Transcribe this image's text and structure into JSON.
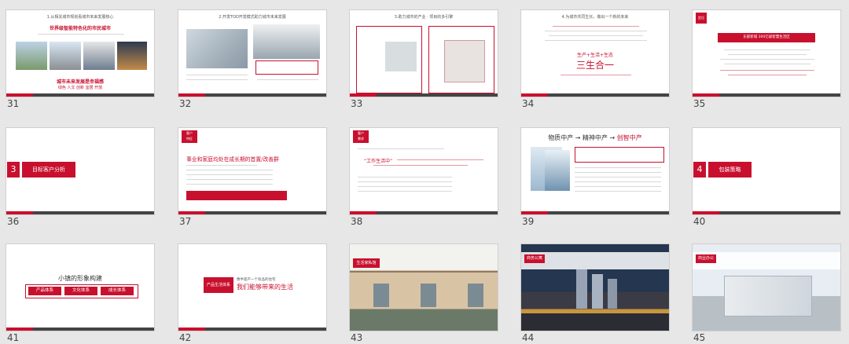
{
  "colors": {
    "accent": "#c8102e",
    "background": "#e7e7e7"
  },
  "slides": [
    {
      "number": "31",
      "title": "1.从相关城市规划看城市未来发展核心",
      "headline": "世界级智能特色化的市民城市",
      "subline": "城市未来发展是幸福感",
      "keywords": "绿色 人文 创新 宜居 开放"
    },
    {
      "number": "32",
      "title": "2.开发TOD开发模式助力城市未来发展"
    },
    {
      "number": "33",
      "title": "3.助力城市的产业 · 项目的多引擎"
    },
    {
      "number": "34",
      "title": "4.为城市共同生长，做出一个新的未来",
      "banner": "生产+生活+生态",
      "headline": "三生合一"
    },
    {
      "number": "35",
      "tag": "定位",
      "banner": "东部新城 300亿级智慧生活区"
    },
    {
      "number": "36",
      "section_index": "3",
      "section_title": "目标客户分析"
    },
    {
      "number": "37",
      "tag": [
        "客户",
        "特征"
      ],
      "headline": "事业和家庭均处在成长期的首置/改善群"
    },
    {
      "number": "38",
      "tag": [
        "客户",
        "需求"
      ],
      "quote": "“工作生活中”"
    },
    {
      "number": "39",
      "headline_a": "物质中产",
      "headline_arrow": "→ 精神中产 →",
      "headline_b": "创智中产"
    },
    {
      "number": "40",
      "section_index": "4",
      "section_title": "包装策略"
    },
    {
      "number": "41",
      "title": "小镇的形象构建",
      "buttons": [
        "产品体系",
        "文化体系",
        "成长体系"
      ]
    },
    {
      "number": "42",
      "tag": "产品生活体系",
      "small": "像半座产一个有品的住宅",
      "headline": "我们能够带来的生活"
    },
    {
      "number": "43",
      "tag": "生活家私馆"
    },
    {
      "number": "44",
      "tag": "商务公寓"
    },
    {
      "number": "45",
      "tag": "商业办公"
    }
  ]
}
